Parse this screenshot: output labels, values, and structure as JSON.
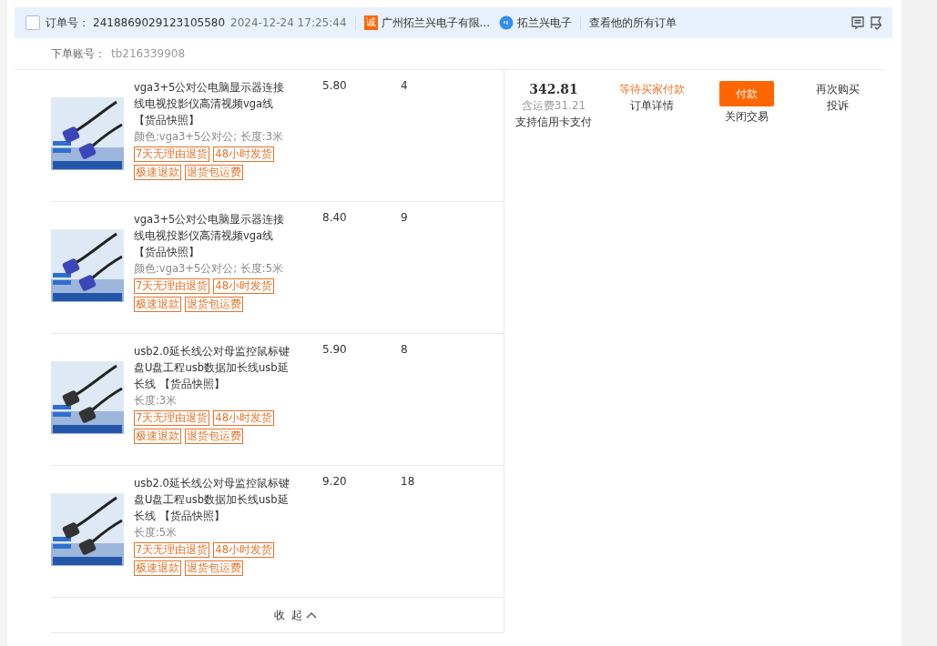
{
  "order": {
    "checked": false,
    "label": "订单号：",
    "number": "2418869029123105580",
    "time": "2024-12-24 17:25:44",
    "shop": "广州拓兰兴电子有限...",
    "shop_badge": "诚",
    "seller": "拓兰兴电子",
    "all_orders": "查看他的所有订单"
  },
  "account": {
    "label": "下单账号：",
    "value": "tb216339908"
  },
  "items": [
    {
      "title": "vga3+5公对公电脑显示器连接线电视投影仪高清视频vga线",
      "snapshot": "【货品快照】",
      "spec": "颜色:vga3+5公对公;  长度:3米",
      "price": "5.80",
      "qty": "4",
      "tags": [
        "7天无理由退货",
        "48小时发货",
        "极速退款",
        "退货包运费"
      ]
    },
    {
      "title": "vga3+5公对公电脑显示器连接线电视投影仪高清视频vga线",
      "snapshot": "【货品快照】",
      "spec": "颜色:vga3+5公对公;  长度:5米",
      "price": "8.40",
      "qty": "9",
      "tags": [
        "7天无理由退货",
        "48小时发货",
        "极速退款",
        "退货包运费"
      ]
    },
    {
      "title": "usb2.0延长线公对母监控鼠标键盘U盘工程usb数据加长线usb延长线",
      "snapshot": "【货品快照】",
      "spec": "长度:3米",
      "price": "5.90",
      "qty": "8",
      "tags": [
        "7天无理由退货",
        "48小时发货",
        "极速退款",
        "退货包运费"
      ]
    },
    {
      "title": "usb2.0延长线公对母监控鼠标键盘U盘工程usb数据加长线usb延长线",
      "snapshot": "【货品快照】",
      "spec": "长度:5米",
      "price": "9.20",
      "qty": "18",
      "tags": [
        "7天无理由退货",
        "48小时发货",
        "极速退款",
        "退货包运费"
      ]
    }
  ],
  "summary": {
    "total": "342.81",
    "shipping": "含运费31.21",
    "credit": "支持信用卡支付",
    "status": "等待买家付款",
    "detail": "订单详情",
    "pay": "付款",
    "close": "关闭交易",
    "rebuy": "再次购买",
    "complain": "投诉"
  },
  "collapse": "收  起"
}
